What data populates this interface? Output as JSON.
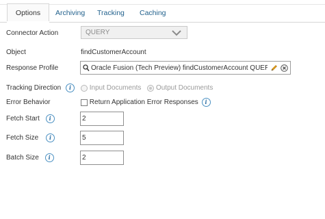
{
  "tabs": [
    {
      "label": "Options",
      "active": true
    },
    {
      "label": "Archiving",
      "active": false
    },
    {
      "label": "Tracking",
      "active": false
    },
    {
      "label": "Caching",
      "active": false
    }
  ],
  "form": {
    "connector_action": {
      "label": "Connector Action",
      "value": "QUERY"
    },
    "object": {
      "label": "Object",
      "value": "findCustomerAccount"
    },
    "response_profile": {
      "label": "Response Profile",
      "value": "Oracle Fusion (Tech Preview) findCustomerAccount QUERY"
    },
    "tracking_direction": {
      "label": "Tracking Direction",
      "options": [
        "Input Documents",
        "Output Documents"
      ],
      "selected": "Output Documents"
    },
    "error_behavior": {
      "label": "Error Behavior",
      "checkbox_label": "Return Application Error Responses",
      "checked": false
    },
    "fetch_start": {
      "label": "Fetch Start",
      "value": "2"
    },
    "fetch_size": {
      "label": "Fetch Size",
      "value": "5"
    },
    "batch_size": {
      "label": "Batch Size",
      "value": "2"
    }
  },
  "icons": {
    "info": "info-icon",
    "dropdown": "chevron-down-icon",
    "search": "search-icon",
    "edit": "pencil-icon",
    "clear": "clear-icon"
  },
  "colors": {
    "link": "#1f5f8b",
    "info": "#2b6ea3",
    "pencil": "#e5a11c"
  }
}
